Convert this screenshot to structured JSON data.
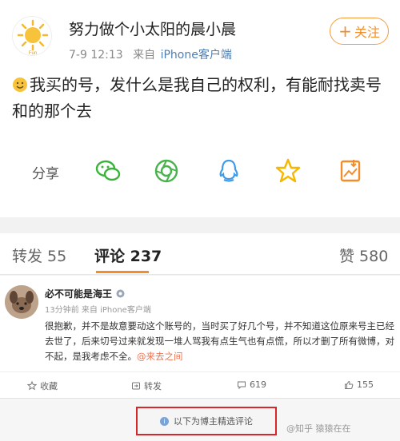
{
  "post": {
    "author": "努力做个小太阳的晨小晨",
    "avatar_caption": "Fun",
    "date": "7-9 12:13",
    "source_prefix": "来自",
    "source_device": "iPhone客户端",
    "follow_label": "关注",
    "content": "我买的号，发什么是我自己的权利，有能耐找卖号和的那个去",
    "share_label": "分享",
    "share_icons": [
      "wechat-icon",
      "moments-icon",
      "qq-icon",
      "qzone-star-icon",
      "save-image-icon"
    ]
  },
  "tabs": {
    "repost": "转发 55",
    "comment": "评论 237",
    "like": "赞 580"
  },
  "comment": {
    "user": "必不可能是海王",
    "meta": "13分钟前 来自 iPhone客户端",
    "text": "很抱歉，并不是故意要动这个账号的，当时买了好几个号，并不知道这位原来号主已经去世了，后来切号过来就发现一堆人骂我有点生气也有点慌，所以才删了所有微博，对不起，是我考虑不全。",
    "mention": "@来去之间",
    "actions": {
      "favorite": "收藏",
      "repost": "转发",
      "comment_count": "619",
      "like_count": "155"
    }
  },
  "footer": {
    "notice": "以下为博主精选评论",
    "watermark": "@知乎 猿猿在在"
  },
  "colors": {
    "accent": "#f28d2a",
    "link": "#507daf",
    "highlight_box": "#d9262a"
  }
}
